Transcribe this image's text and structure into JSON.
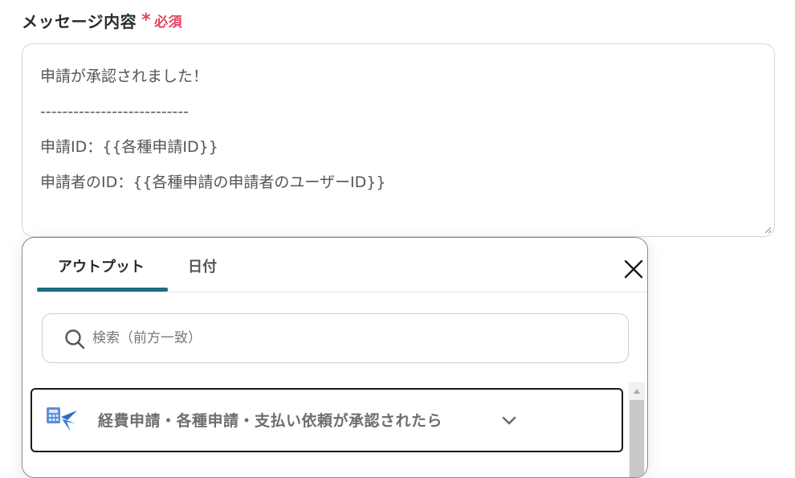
{
  "field": {
    "label": "メッセージ内容",
    "required_mark": "*",
    "required_text": "必須"
  },
  "message": {
    "lines": [
      "申請が承認されました！",
      "---------------------------",
      "申請ID：{{各種申請ID}}",
      "申請者のID：{{各種申請の申請者のユーザーID}}"
    ]
  },
  "popup": {
    "tabs": [
      {
        "label": "アウトプット",
        "active": true
      },
      {
        "label": "日付",
        "active": false
      }
    ],
    "search": {
      "placeholder": "検索（前方一致）",
      "value": ""
    },
    "group": {
      "title": "経費申請・各種申請・支払い依頼が承認されたら",
      "icon": "expense-app-icon",
      "expanded": false
    }
  },
  "colors": {
    "accent": "#1f6e82",
    "required": "#e0455e",
    "border": "#d4d4d4"
  }
}
